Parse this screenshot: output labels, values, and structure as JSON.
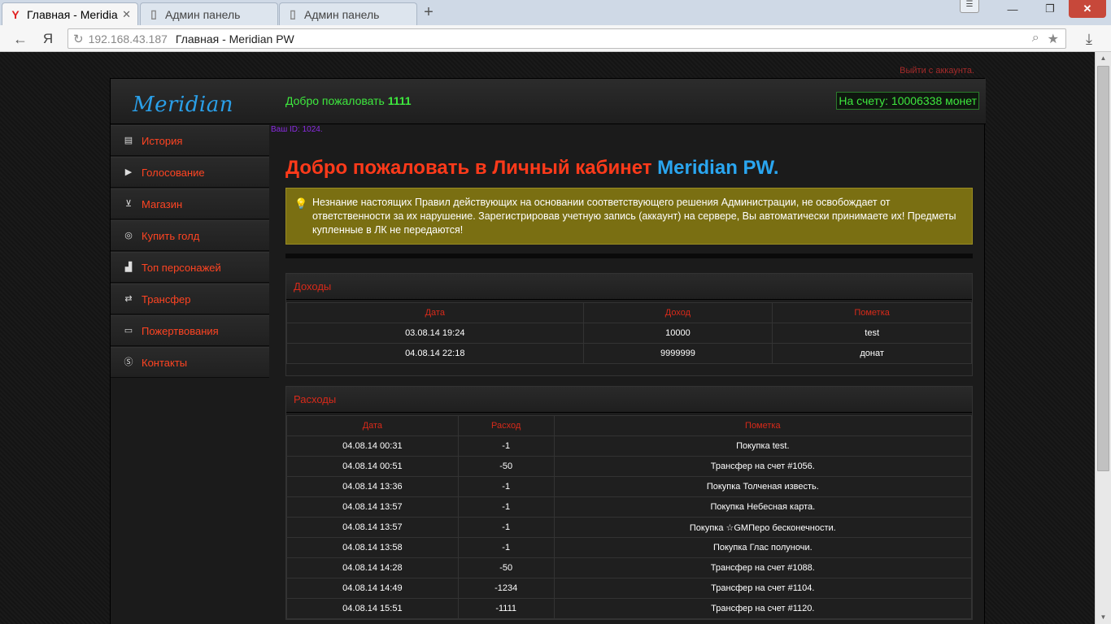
{
  "browser": {
    "tabs": [
      {
        "title": "Главная - Meridia",
        "active": true
      },
      {
        "title": "Админ панель",
        "active": false
      },
      {
        "title": "Админ панель",
        "active": false
      }
    ],
    "address_host": "192.168.43.187",
    "address_title": "Главная - Meridian PW",
    "new_tab": "+",
    "minimize": "—",
    "maximize": "❐",
    "close": "✕"
  },
  "page": {
    "logout": "Выйти с аккаунта.",
    "logo": "Meridian",
    "welcome_prefix": "Добро пожаловать ",
    "username": "1111",
    "balance": "На счету: 10006338 монет",
    "user_id": "Ваш ID: 1024.",
    "title_main": "Добро пожаловать в Личный кабинет ",
    "title_accent": "Meridian PW.",
    "notice": "Незнание настоящих Правил действующих на основании соответствующего решения Администрации, не освобождает от ответственности за их нарушение. Зарегистрировав учетную запись (аккаунт) на сервере, Вы автоматически принимаете их! Предметы купленные в ЛК не передаются!"
  },
  "sidebar": {
    "items": [
      {
        "label": "История",
        "icon": "book-icon"
      },
      {
        "label": "Голосование",
        "icon": "play-icon"
      },
      {
        "label": "Магазин",
        "icon": "cart-icon"
      },
      {
        "label": "Купить голд",
        "icon": "coins-icon"
      },
      {
        "label": "Топ персонажей",
        "icon": "podium-icon"
      },
      {
        "label": "Трансфер",
        "icon": "shuffle-icon"
      },
      {
        "label": "Пожертвования",
        "icon": "cash-icon"
      },
      {
        "label": "Контакты",
        "icon": "skype-icon"
      }
    ]
  },
  "income": {
    "title": "Доходы",
    "headers": [
      "Дата",
      "Доход",
      "Пометка"
    ],
    "rows": [
      [
        "03.08.14 19:24",
        "10000",
        "test"
      ],
      [
        "04.08.14 22:18",
        "9999999",
        "донат"
      ]
    ]
  },
  "expenses": {
    "title": "Расходы",
    "headers": [
      "Дата",
      "Расход",
      "Пометка"
    ],
    "rows": [
      [
        "04.08.14 00:31",
        "-1",
        "Покупка test."
      ],
      [
        "04.08.14 00:51",
        "-50",
        "Трансфер на счет #1056."
      ],
      [
        "04.08.14 13:36",
        "-1",
        "Покупка Толченая известь."
      ],
      [
        "04.08.14 13:57",
        "-1",
        "Покупка Небесная карта."
      ],
      [
        "04.08.14 13:57",
        "-1",
        "Покупка ☆GMПеро бесконечности."
      ],
      [
        "04.08.14 13:58",
        "-1",
        "Покупка Глас полуночи."
      ],
      [
        "04.08.14 14:28",
        "-50",
        "Трансфер на счет #1088."
      ],
      [
        "04.08.14 14:49",
        "-1234",
        "Трансфер на счет #1104."
      ],
      [
        "04.08.14 15:51",
        "-1111",
        "Трансфер на счет #1120."
      ]
    ]
  }
}
